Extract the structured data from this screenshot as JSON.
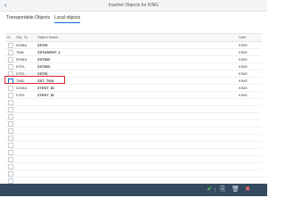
{
  "window": {
    "title": "Inactive Objects for KING",
    "back_label": "‹"
  },
  "tabs": [
    {
      "label": "Transportable Objects"
    },
    {
      "label": "Local objects"
    }
  ],
  "table": {
    "columns": {
      "check": "O..",
      "type": "Obj. Ty...",
      "name": "Object Name",
      "user": "User"
    },
    "rows": [
      {
        "type": "DOMA",
        "name": "ZSTID",
        "user": "KING",
        "selected": false
      },
      {
        "type": "TABL",
        "name": "ZSTUDENT_1",
        "user": "KING",
        "selected": false
      },
      {
        "type": "DOMA",
        "name": "ZSTSID",
        "user": "KING",
        "selected": false
      },
      {
        "type": "DTEL",
        "name": "ZSTSID",
        "user": "KING",
        "selected": false
      },
      {
        "type": "DTEL",
        "name": "ZSTID",
        "user": "KING",
        "selected": false
      },
      {
        "type": "TABL",
        "name": "ZST_T001",
        "user": "KING",
        "selected": true
      },
      {
        "type": "DOMA",
        "name": "ZTEST_ID",
        "user": "KING",
        "selected": false
      },
      {
        "type": "DTEL",
        "name": "ZTEST_ID",
        "user": "KING",
        "selected": false
      },
      {
        "type": "",
        "name": "",
        "user": "",
        "selected": false
      },
      {
        "type": "",
        "name": "",
        "user": "",
        "selected": false
      },
      {
        "type": "",
        "name": "",
        "user": "",
        "selected": false
      },
      {
        "type": "",
        "name": "",
        "user": "",
        "selected": false
      },
      {
        "type": "",
        "name": "",
        "user": "",
        "selected": false
      },
      {
        "type": "",
        "name": "",
        "user": "",
        "selected": false
      },
      {
        "type": "",
        "name": "",
        "user": "",
        "selected": false
      },
      {
        "type": "",
        "name": "",
        "user": "",
        "selected": false
      },
      {
        "type": "",
        "name": "",
        "user": "",
        "selected": false
      },
      {
        "type": "",
        "name": "",
        "user": "",
        "selected": false
      },
      {
        "type": "",
        "name": "",
        "user": "",
        "selected": false
      },
      {
        "type": "",
        "name": "",
        "user": "",
        "selected": false
      }
    ]
  },
  "footer": {
    "buttons": [
      {
        "icon": "activate-icon",
        "glyph": "✔"
      },
      {
        "icon": "copy-icon",
        "glyph": "⎘"
      },
      {
        "icon": "delete-icon",
        "glyph": "🗑"
      },
      {
        "icon": "cancel-icon",
        "glyph": "✖"
      }
    ]
  },
  "colors": {
    "accent": "#0a6ed1",
    "highlight": "#e0242f",
    "footer": "#354a5f"
  }
}
